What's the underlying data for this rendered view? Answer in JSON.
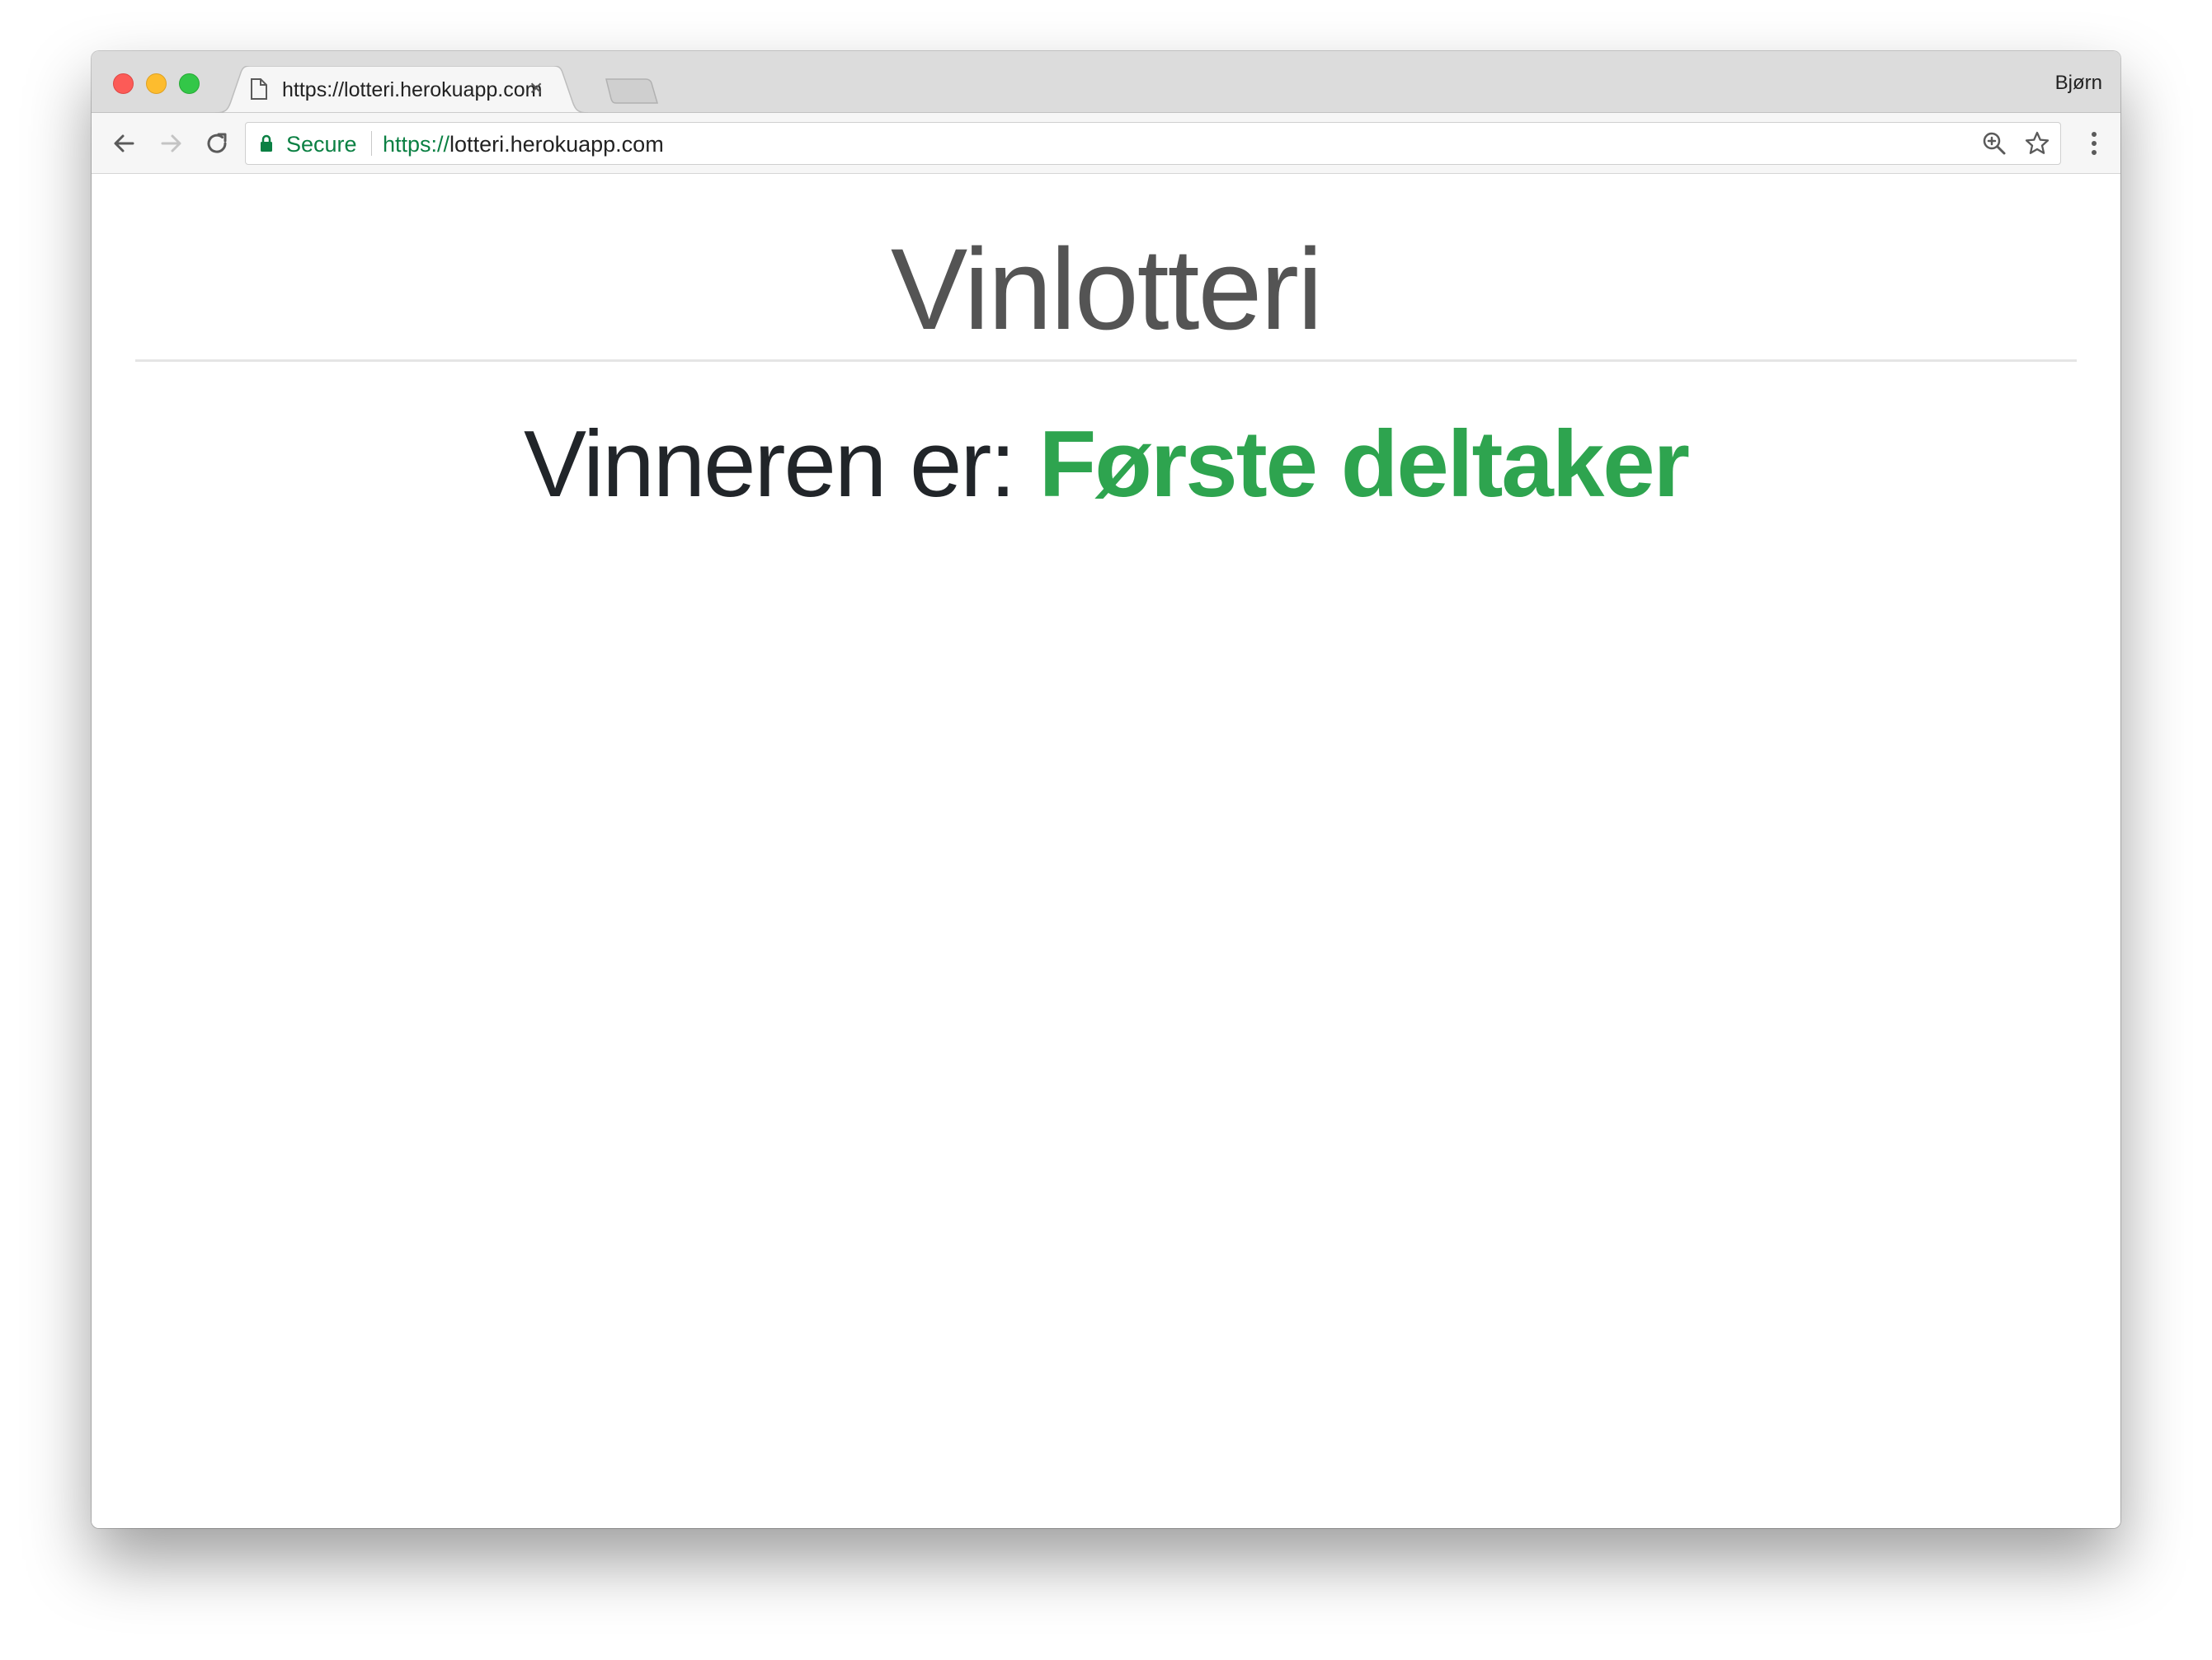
{
  "browser": {
    "tab": {
      "title": "https://lotteri.herokuapp.com",
      "close_glyph": "×",
      "favicon": "document-icon"
    },
    "profile_name": "Bjørn",
    "toolbar": {
      "back_icon": "arrow-left-icon",
      "forward_icon": "arrow-right-icon",
      "reload_icon": "reload-icon"
    },
    "omnibox": {
      "security_label": "Secure",
      "url_scheme": "https://",
      "url_host": "lotteri.herokuapp.com",
      "zoom_icon": "zoom-icon",
      "bookmark_icon": "star-icon"
    },
    "menu_icon": "kebab-menu-icon",
    "colors": {
      "secure_green": "#0b8043",
      "close": "#fc5b57",
      "minimize": "#fdbc2e",
      "maximize": "#33c748"
    }
  },
  "page": {
    "title": "Vinlotteri",
    "winner_prefix": "Vinneren er:",
    "winner_name": "Første deltaker",
    "colors": {
      "title": "#545454",
      "winner_name": "#2ea44f",
      "text": "#212529"
    }
  }
}
